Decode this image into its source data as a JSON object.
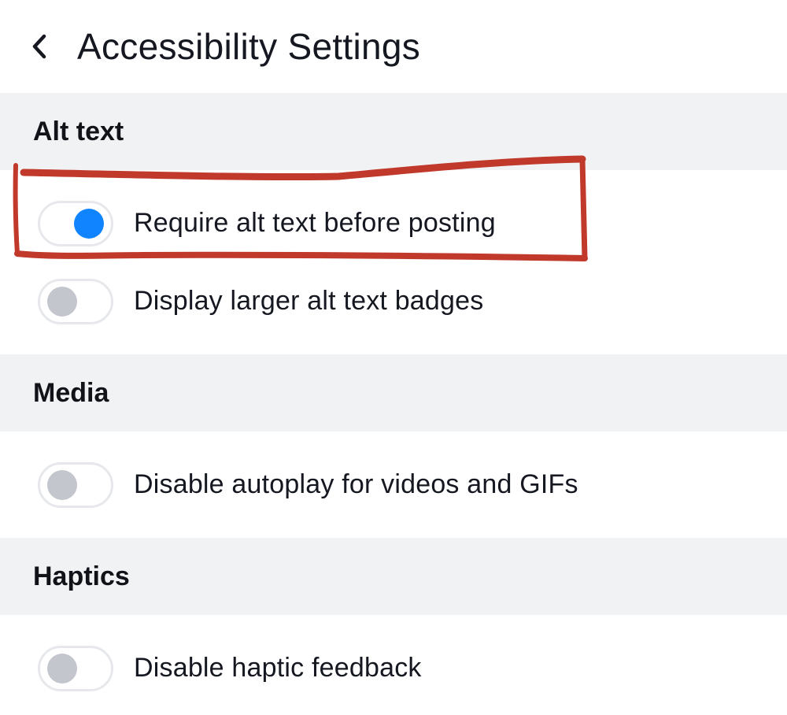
{
  "header": {
    "title": "Accessibility Settings",
    "back_icon": "chevron-left-icon"
  },
  "sections": [
    {
      "title": "Alt text",
      "items": [
        {
          "label": "Require alt text before posting",
          "on": true
        },
        {
          "label": "Display larger alt text badges",
          "on": false
        }
      ]
    },
    {
      "title": "Media",
      "items": [
        {
          "label": "Disable autoplay for videos and GIFs",
          "on": false
        }
      ]
    },
    {
      "title": "Haptics",
      "items": [
        {
          "label": "Disable haptic feedback",
          "on": false
        }
      ]
    }
  ],
  "colors": {
    "toggle_on": "#1083fe",
    "toggle_off": "#c4c6cd",
    "section_bg": "#f1f2f4",
    "annotation": "#c0392b"
  }
}
